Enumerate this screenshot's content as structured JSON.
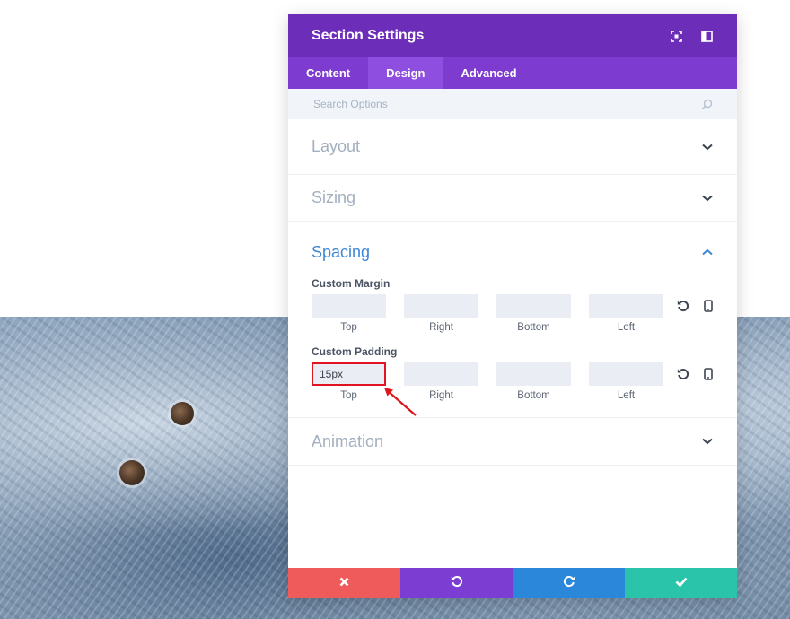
{
  "panel": {
    "title": "Section Settings",
    "tabs": [
      {
        "label": "Content"
      },
      {
        "label": "Design"
      },
      {
        "label": "Advanced"
      }
    ],
    "active_tab": "Design",
    "search": {
      "placeholder": "Search Options",
      "value": ""
    },
    "sections": {
      "layout": {
        "title": "Layout"
      },
      "sizing": {
        "title": "Sizing"
      },
      "spacing": {
        "title": "Spacing",
        "custom_margin": {
          "label": "Custom Margin",
          "fields": [
            {
              "caption": "Top",
              "value": ""
            },
            {
              "caption": "Right",
              "value": ""
            },
            {
              "caption": "Bottom",
              "value": ""
            },
            {
              "caption": "Left",
              "value": ""
            }
          ]
        },
        "custom_padding": {
          "label": "Custom Padding",
          "fields": [
            {
              "caption": "Top",
              "value": "15px"
            },
            {
              "caption": "Right",
              "value": ""
            },
            {
              "caption": "Bottom",
              "value": ""
            },
            {
              "caption": "Left",
              "value": ""
            }
          ]
        }
      },
      "animation": {
        "title": "Animation"
      }
    }
  },
  "colors": {
    "header": "#6c2eb9",
    "tabs": "#7d3bd0",
    "active_tab": "#8e4ee0",
    "open_section": "#3e87d6",
    "cancel": "#ef5b5b",
    "undo": "#7c3dd2",
    "redo": "#2b87da",
    "save": "#29c4a9",
    "annotation": "#e0151f"
  },
  "icons": {
    "header": [
      "fullscreen-icon",
      "split-view-icon"
    ],
    "footer": [
      "close-icon",
      "undo-icon",
      "redo-icon",
      "check-icon"
    ]
  }
}
